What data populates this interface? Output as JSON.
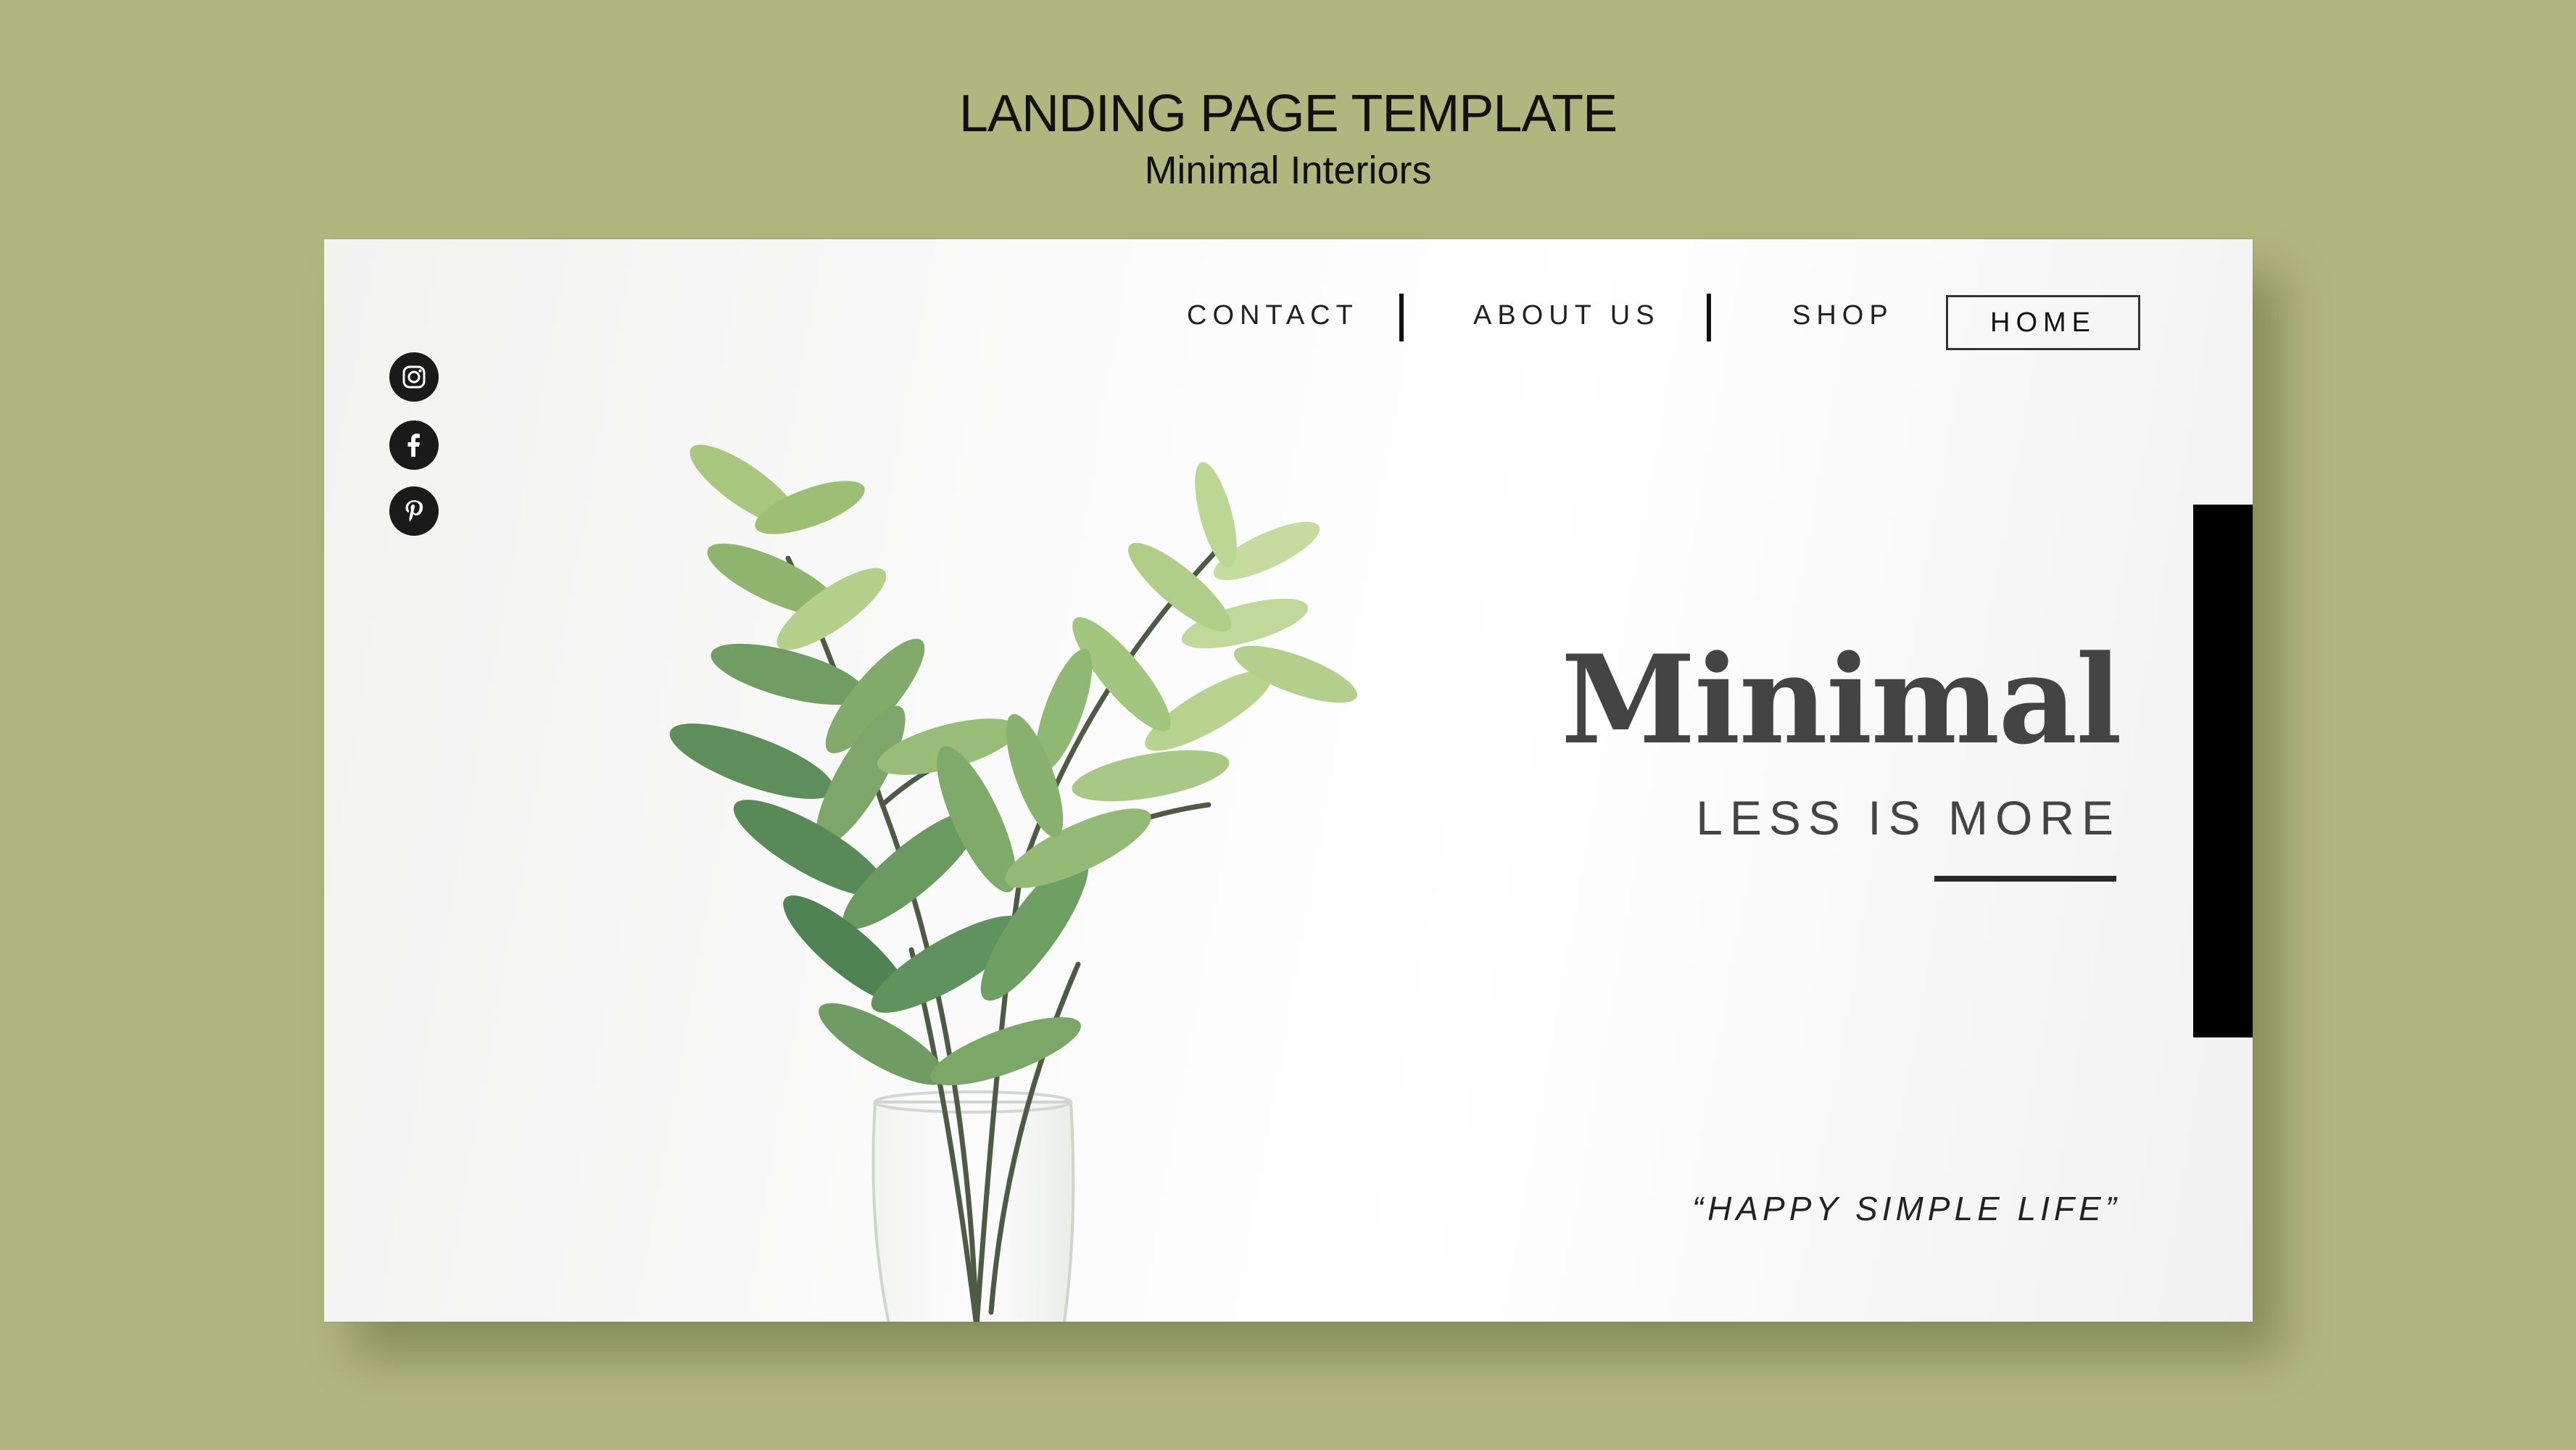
{
  "mockup": {
    "title": "LANDING PAGE TEMPLATE",
    "subtitle": "Minimal Interiors"
  },
  "nav": {
    "items": [
      {
        "label": "CONTACT"
      },
      {
        "label": "ABOUT US"
      },
      {
        "label": "SHOP"
      }
    ],
    "active": "HOME"
  },
  "social": {
    "icons": [
      "instagram-icon",
      "facebook-icon",
      "pinterest-icon"
    ]
  },
  "hero": {
    "headline": "Minimal",
    "tagline": "LESS IS MORE",
    "quote": "“HAPPY SIMPLE LIFE”"
  },
  "colors": {
    "background": "#b0b77e",
    "text": "#444444",
    "accent_bar": "#000000",
    "leaf": "#7aa36a"
  }
}
